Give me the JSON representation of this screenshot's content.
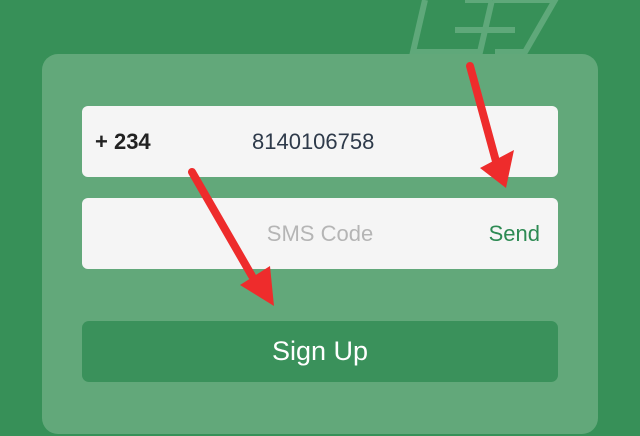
{
  "colors": {
    "background": "#379058",
    "card": "#62a87a",
    "field": "#f5f5f5",
    "accent": "#2d8a53",
    "button": "#3a915b",
    "annotation_arrow": "#ee2c2c"
  },
  "icons": [
    "app-logo-icon",
    "annotation-arrow-icon"
  ],
  "phone": {
    "country_code": "+ 234",
    "number": "8140106758"
  },
  "sms": {
    "placeholder": "SMS Code",
    "send_label": "Send"
  },
  "signup": {
    "label": "Sign Up"
  }
}
